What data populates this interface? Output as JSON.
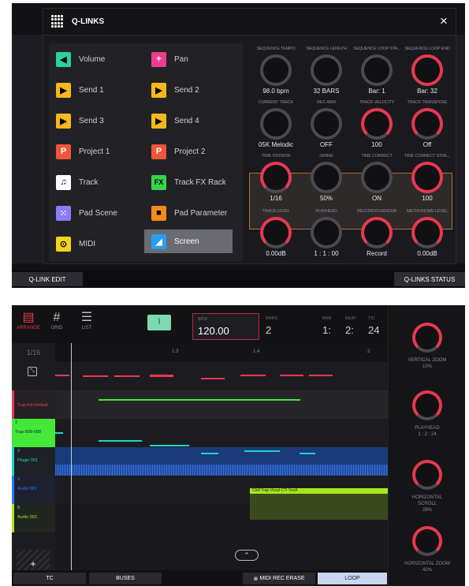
{
  "qlinks": {
    "title": "Q-LINKS",
    "close": "×",
    "items": [
      {
        "label": "Volume",
        "icon": "speaker-icon",
        "glyph": "◀",
        "color": "#2ad1a3"
      },
      {
        "label": "Pan",
        "icon": "pan-icon",
        "glyph": "+",
        "color": "#ef3c8f"
      },
      {
        "label": "Send 1",
        "icon": "send-icon",
        "glyph": "▶",
        "color": "#f5b81a"
      },
      {
        "label": "Send 2",
        "icon": "send-icon",
        "glyph": "▶",
        "color": "#f5b81a"
      },
      {
        "label": "Send 3",
        "icon": "send-icon",
        "glyph": "▶",
        "color": "#f5b81a"
      },
      {
        "label": "Send 4",
        "icon": "send-icon",
        "glyph": "▶",
        "color": "#f5b81a"
      },
      {
        "label": "Project 1",
        "icon": "project-icon",
        "glyph": "P",
        "color": "#f0553a"
      },
      {
        "label": "Project 2",
        "icon": "project-icon",
        "glyph": "P",
        "color": "#f0553a"
      },
      {
        "label": "Track",
        "icon": "note-icon",
        "glyph": "♫",
        "color": "#ffffff"
      },
      {
        "label": "Track FX Rack",
        "icon": "fx-icon",
        "glyph": "FX",
        "color": "#36d44a"
      },
      {
        "label": "Pad Scene",
        "icon": "pad-grid-icon",
        "glyph": "⁙",
        "color": "#8a7df5"
      },
      {
        "label": "Pad Parameter",
        "icon": "pad-parameter-icon",
        "glyph": "■",
        "color": "#f28a1e"
      },
      {
        "label": "MIDI",
        "icon": "midi-icon",
        "glyph": "⊙",
        "color": "#f5d41a"
      },
      {
        "label": "Screen",
        "icon": "screen-icon",
        "glyph": "◢",
        "color": "#2a9df4"
      }
    ],
    "subscripts": [
      "",
      "",
      "",
      "2",
      "3",
      "4",
      "1",
      "2"
    ],
    "knobs": [
      {
        "label": "SEQUENCE TEMPO",
        "value": "98.0 bpm"
      },
      {
        "label": "SEQUENCE LENGTH",
        "value": "32 BARS"
      },
      {
        "label": "SEQUENCE LOOP STA...",
        "value": "Bar: 1"
      },
      {
        "label": "SEQUENCE LOOP END",
        "value": "Bar: 32"
      },
      {
        "label": "CURRENT TRACK",
        "value": "05K Melodic"
      },
      {
        "label": "REC ARM",
        "value": "OFF"
      },
      {
        "label": "TRACK VELOCITY",
        "value": "100"
      },
      {
        "label": "TRACK TRANSPOSE",
        "value": "Off"
      },
      {
        "label": "TIME DIVISION",
        "value": "1/16"
      },
      {
        "label": "SWING",
        "value": "50%"
      },
      {
        "label": "TIME CORRECT",
        "value": "ON"
      },
      {
        "label": "TIME CORRECT STRE...",
        "value": "100"
      },
      {
        "label": "TRACK LEVEL",
        "value": "0.00dB"
      },
      {
        "label": "PLAYHEAD",
        "value": "1 : 1 : 00"
      },
      {
        "label": "RECORD/OVERDUB",
        "value": "Record"
      },
      {
        "label": "METRONOME LEVEL",
        "value": "0.00dB"
      }
    ],
    "bottom_left": "Q-LINK EDIT",
    "bottom_right": "Q-LINKS STATUS"
  },
  "arrange": {
    "tabs": [
      {
        "label": "ARRANGE",
        "icon": "arrange-icon"
      },
      {
        "label": "GRID",
        "icon": "grid-icon"
      },
      {
        "label": "LIST",
        "icon": "list-icon"
      }
    ],
    "bpm_label": "BPM",
    "bpm": "120.00",
    "bars_label": "BARS",
    "bars": "2",
    "bar_label": "BAR",
    "bar": "1:",
    "beat_label": "BEAT",
    "beat": "2:",
    "tick_label": "TIC",
    "tick": "24",
    "quant": "1/16",
    "ruler": [
      "1.3",
      "1.4",
      "2"
    ],
    "tracks": [
      {
        "name": "Trap-Kit-Default",
        "color": "#e8384f"
      },
      {
        "name": "Trap-808-008",
        "color": "#44e838",
        "num": "2"
      },
      {
        "name": "Plugin 001",
        "color": "#1ad6c8",
        "num": "3"
      },
      {
        "name": "Audio 001",
        "color": "#2a7af4",
        "num": "4"
      },
      {
        "name": "Audio 002",
        "color": "#a8e81a",
        "num": "5"
      }
    ],
    "clip_label": "Chill Trap-Vocal CTI VoxA",
    "knobs": [
      {
        "label": "VERTICAL ZOOM",
        "value": "10%"
      },
      {
        "label": "PLAYHEAD",
        "value": "1 : 2 : 24"
      },
      {
        "label": "HORIZONTAL SCROLL",
        "value": "28%"
      },
      {
        "label": "HORIZONTAL ZOOM",
        "value": "42%"
      }
    ],
    "bottom": {
      "tc": "TC",
      "buses": "BUSES",
      "midi_rec_erase": "MIDI REC ERASE",
      "loop": "LOOP"
    }
  }
}
